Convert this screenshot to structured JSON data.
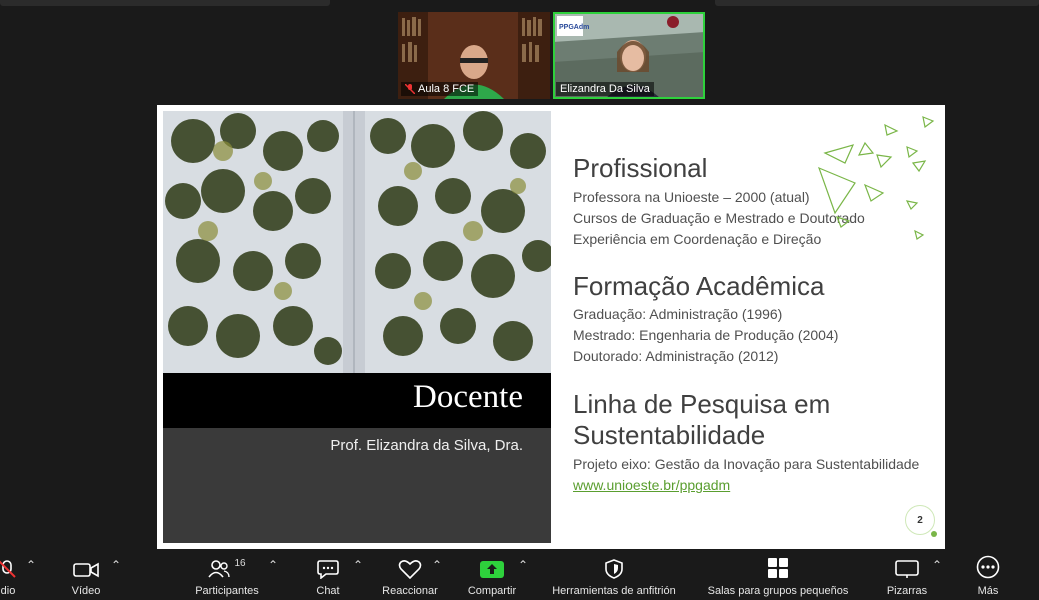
{
  "participants": [
    {
      "name": "Aula 8 FCE",
      "muted": true
    },
    {
      "name": "Elizandra Da Silva",
      "muted": false
    }
  ],
  "slide": {
    "title": "Docente",
    "subtitle": "Prof. Elizandra da Silva, Dra.",
    "sections": [
      {
        "heading": "Profissional",
        "lines": [
          "Professora na Unioeste – 2000 (atual)",
          "Cursos de Graduação e Mestrado e Doutorado",
          "Experiência em Coordenação e Direção"
        ]
      },
      {
        "heading": "Formação Acadêmica",
        "lines": [
          "Graduação: Administração (1996)",
          "Mestrado: Engenharia de Produção (2004)",
          "Doutorado: Administração (2012)"
        ]
      },
      {
        "heading_line1": "Linha de Pesquisa  em",
        "heading_line2": "Sustentabilidade",
        "lines": [
          "Projeto eixo: Gestão da Inovação para Sustentabilidade"
        ],
        "link": "www.unioeste.br/ppgadm"
      }
    ],
    "page_number": "2",
    "accent_color": "#7ab648"
  },
  "toolbar": {
    "audio": "dio",
    "video": "Vídeo",
    "participants": "Participantes",
    "participants_count": "16",
    "chat": "Chat",
    "react": "Reaccionar",
    "share": "Compartir",
    "host_tools": "Herramientas de anfitrión",
    "breakout": "Salas para grupos pequeños",
    "whiteboards": "Pizarras",
    "more": "Más"
  },
  "colors": {
    "share_green": "#2ed13c",
    "background": "#1a1a1a"
  }
}
